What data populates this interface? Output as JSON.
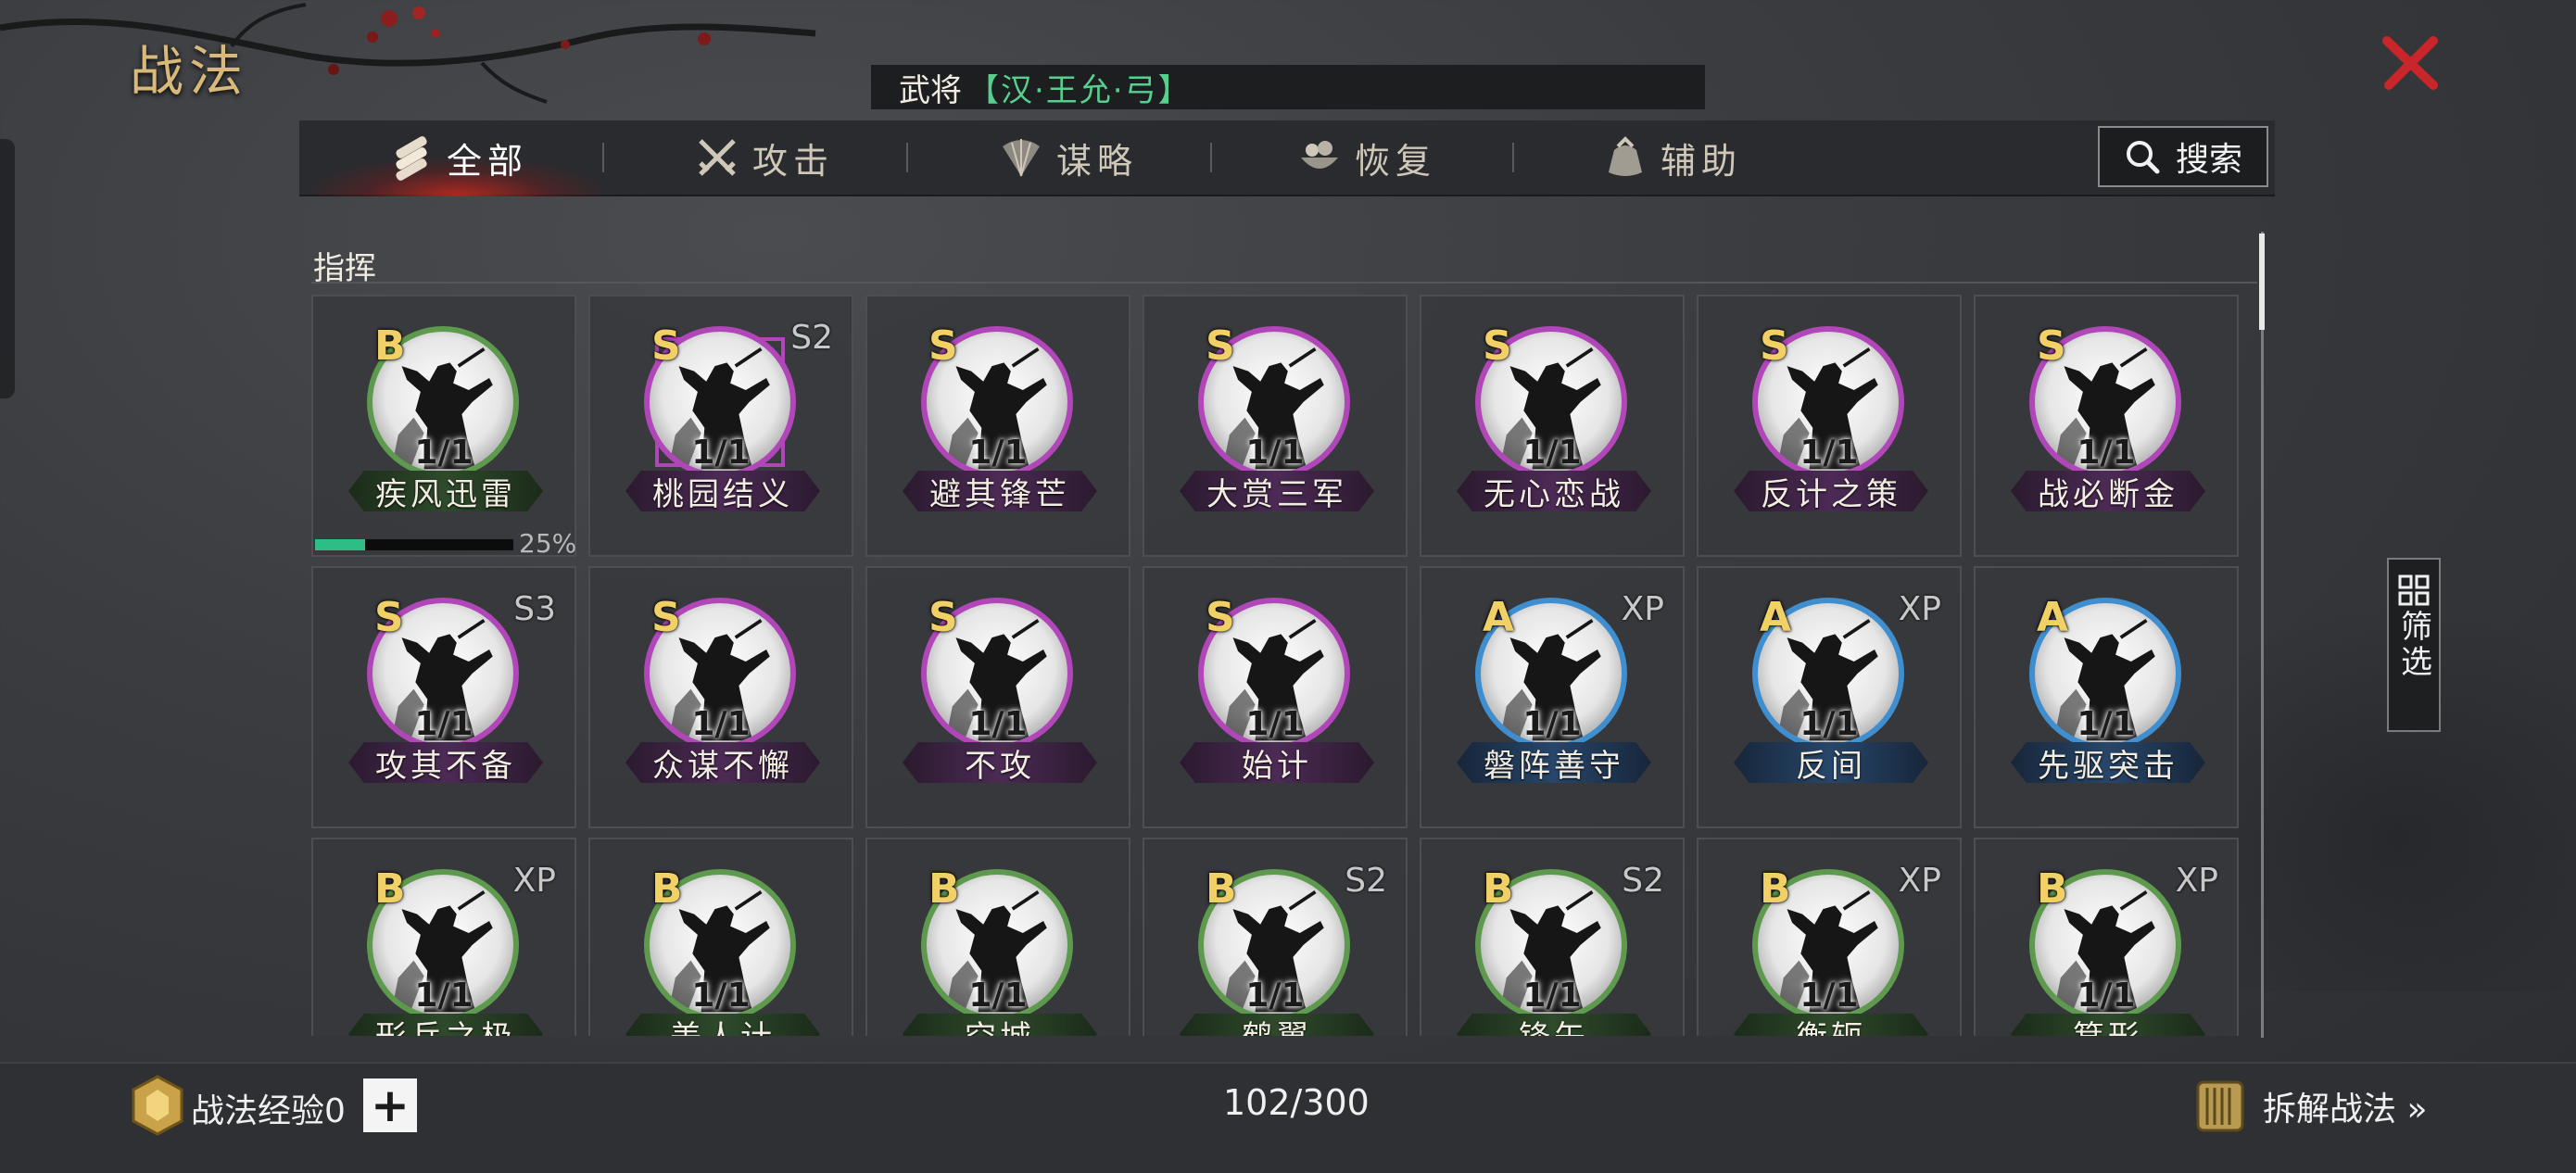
{
  "header": {
    "title": "战法",
    "general_label": "武将",
    "general_value": "【汉·王允·弓】"
  },
  "tabs": [
    {
      "label": "全部",
      "icon": "scroll-bundle-icon",
      "active": true
    },
    {
      "label": "攻击",
      "icon": "crossed-swords-icon",
      "active": false
    },
    {
      "label": "谋略",
      "icon": "feather-fan-icon",
      "active": false
    },
    {
      "label": "恢复",
      "icon": "herb-bowl-icon",
      "active": false
    },
    {
      "label": "辅助",
      "icon": "pouch-icon",
      "active": false
    }
  ],
  "search": {
    "label": "搜索"
  },
  "section": {
    "label": "指挥"
  },
  "filter": {
    "label": "筛选"
  },
  "tactics": [
    {
      "grade": "B",
      "season": "",
      "level": "1/1",
      "name": "疾风迅雷",
      "quality": "green",
      "progress": 0.25,
      "progress_text": "25%"
    },
    {
      "grade": "S",
      "season": "S2",
      "level": "1/1",
      "name": "桃园结义",
      "quality": "purple",
      "frame": true
    },
    {
      "grade": "S",
      "season": "",
      "level": "1/1",
      "name": "避其锋芒",
      "quality": "purple"
    },
    {
      "grade": "S",
      "season": "",
      "level": "1/1",
      "name": "大赏三军",
      "quality": "purple"
    },
    {
      "grade": "S",
      "season": "",
      "level": "1/1",
      "name": "无心恋战",
      "quality": "purple"
    },
    {
      "grade": "S",
      "season": "",
      "level": "1/1",
      "name": "反计之策",
      "quality": "purple"
    },
    {
      "grade": "S",
      "season": "",
      "level": "1/1",
      "name": "战必断金",
      "quality": "purple"
    },
    {
      "grade": "S",
      "season": "S3",
      "level": "1/1",
      "name": "攻其不备",
      "quality": "purple"
    },
    {
      "grade": "S",
      "season": "",
      "level": "1/1",
      "name": "众谋不懈",
      "quality": "purple"
    },
    {
      "grade": "S",
      "season": "",
      "level": "1/1",
      "name": "不攻",
      "quality": "purple"
    },
    {
      "grade": "S",
      "season": "",
      "level": "1/1",
      "name": "始计",
      "quality": "purple"
    },
    {
      "grade": "A",
      "season": "XP",
      "level": "1/1",
      "name": "磐阵善守",
      "quality": "blue"
    },
    {
      "grade": "A",
      "season": "XP",
      "level": "1/1",
      "name": "反间",
      "quality": "blue"
    },
    {
      "grade": "A",
      "season": "",
      "level": "1/1",
      "name": "先驱突击",
      "quality": "blue"
    },
    {
      "grade": "B",
      "season": "XP",
      "level": "1/1",
      "name": "形兵之极",
      "quality": "green"
    },
    {
      "grade": "B",
      "season": "",
      "level": "1/1",
      "name": "美人计",
      "quality": "green"
    },
    {
      "grade": "B",
      "season": "",
      "level": "1/1",
      "name": "空城",
      "quality": "green"
    },
    {
      "grade": "B",
      "season": "S2",
      "level": "1/1",
      "name": "鹤翼",
      "quality": "green"
    },
    {
      "grade": "B",
      "season": "S2",
      "level": "1/1",
      "name": "锋矢",
      "quality": "green"
    },
    {
      "grade": "B",
      "season": "XP",
      "level": "1/1",
      "name": "衡轭",
      "quality": "green"
    },
    {
      "grade": "B",
      "season": "XP",
      "level": "1/1",
      "name": "箕形",
      "quality": "green"
    }
  ],
  "footer": {
    "exp_label": "战法经验0",
    "plus": "+",
    "count": "102/300",
    "disassemble": "拆解战法 »"
  },
  "colors": {
    "accent_gold": "#d9b979",
    "general_green": "#57d08f",
    "close_red": "#c8262a",
    "progress_green": "#2dbd85",
    "quality_green": "#5d9a4d",
    "quality_purple": "#b146b8",
    "quality_blue": "#3f8fd0"
  }
}
